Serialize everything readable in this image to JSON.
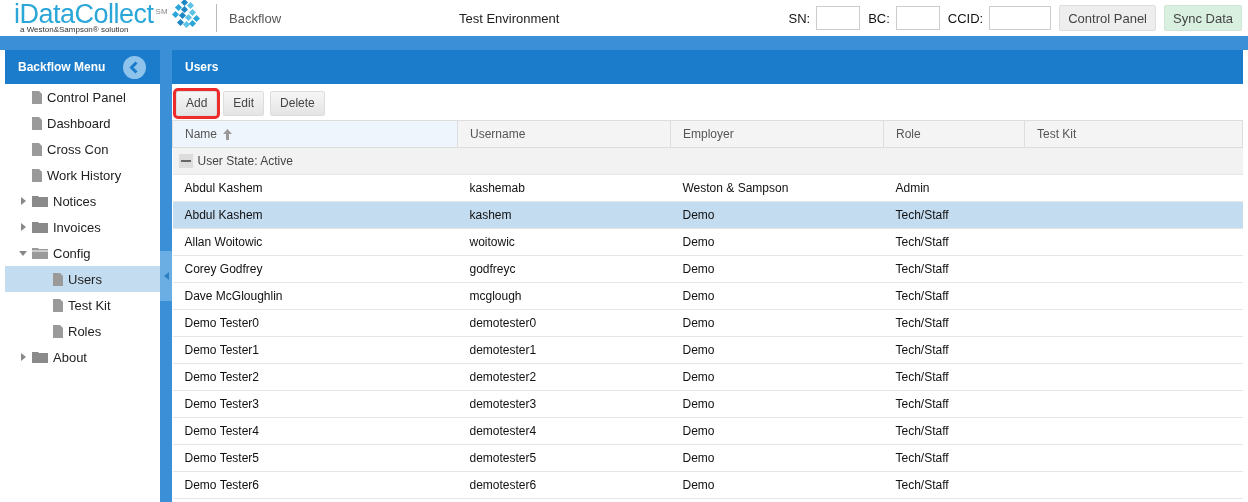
{
  "header": {
    "logo_name": "iDataCollect",
    "logo_mark": "SM",
    "tagline": "a Weston&Sampson® solution",
    "module": "Backflow",
    "environment": "Test Environment",
    "fields": [
      {
        "label": "SN:"
      },
      {
        "label": "BC:"
      },
      {
        "label": "CCID:"
      }
    ],
    "buttons": [
      {
        "label": "Control Panel",
        "kind": "plain"
      },
      {
        "label": "Sync Data",
        "kind": "sync"
      }
    ]
  },
  "sidebar": {
    "title": "Backflow Menu",
    "items": [
      {
        "label": "Control Panel",
        "kind": "file",
        "selected": false
      },
      {
        "label": "Dashboard",
        "kind": "file",
        "selected": false
      },
      {
        "label": "Cross Con",
        "kind": "file",
        "selected": false
      },
      {
        "label": "Work History",
        "kind": "file",
        "selected": false
      },
      {
        "label": "Notices",
        "kind": "folder",
        "expanded": false,
        "selected": false
      },
      {
        "label": "Invoices",
        "kind": "folder",
        "expanded": false,
        "selected": false
      },
      {
        "label": "Config",
        "kind": "folder",
        "expanded": true,
        "selected": false,
        "children": [
          {
            "label": "Users",
            "kind": "file",
            "selected": true
          },
          {
            "label": "Test Kit",
            "kind": "file",
            "selected": false
          },
          {
            "label": "Roles",
            "kind": "file",
            "selected": false
          }
        ]
      },
      {
        "label": "About",
        "kind": "folder",
        "expanded": false,
        "selected": false
      }
    ]
  },
  "panel": {
    "title": "Users",
    "toolbar": [
      {
        "label": "Add",
        "highlighted": true
      },
      {
        "label": "Edit",
        "highlighted": false
      },
      {
        "label": "Delete",
        "highlighted": false
      }
    ],
    "table": {
      "columns": [
        {
          "label": "Name",
          "sorted": true
        },
        {
          "label": "Username",
          "sorted": false
        },
        {
          "label": "Employer",
          "sorted": false
        },
        {
          "label": "Role",
          "sorted": false
        },
        {
          "label": "Test Kit",
          "sorted": false
        }
      ],
      "group": "User State: Active",
      "rows": [
        {
          "cells": [
            "Abdul Kashem",
            "kashemab",
            "Weston & Sampson",
            "Admin"
          ],
          "selected": false
        },
        {
          "cells": [
            "Abdul Kashem",
            "kashem",
            "Demo",
            "Tech/Staff"
          ],
          "selected": true
        },
        {
          "cells": [
            "Allan Woitowic",
            "woitowic",
            "Demo",
            "Tech/Staff"
          ],
          "selected": false
        },
        {
          "cells": [
            "Corey Godfrey",
            "godfreyc",
            "Demo",
            "Tech/Staff"
          ],
          "selected": false
        },
        {
          "cells": [
            "Dave McGloughlin",
            "mcglough",
            "Demo",
            "Tech/Staff"
          ],
          "selected": false
        },
        {
          "cells": [
            "Demo Tester0",
            "demotester0",
            "Demo",
            "Tech/Staff"
          ],
          "selected": false
        },
        {
          "cells": [
            "Demo Tester1",
            "demotester1",
            "Demo",
            "Tech/Staff"
          ],
          "selected": false
        },
        {
          "cells": [
            "Demo Tester2",
            "demotester2",
            "Demo",
            "Tech/Staff"
          ],
          "selected": false
        },
        {
          "cells": [
            "Demo Tester3",
            "demotester3",
            "Demo",
            "Tech/Staff"
          ],
          "selected": false
        },
        {
          "cells": [
            "Demo Tester4",
            "demotester4",
            "Demo",
            "Tech/Staff"
          ],
          "selected": false
        },
        {
          "cells": [
            "Demo Tester5",
            "demotester5",
            "Demo",
            "Tech/Staff"
          ],
          "selected": false
        },
        {
          "cells": [
            "Demo Tester6",
            "demotester6",
            "Demo",
            "Tech/Staff"
          ],
          "selected": false
        }
      ]
    }
  }
}
